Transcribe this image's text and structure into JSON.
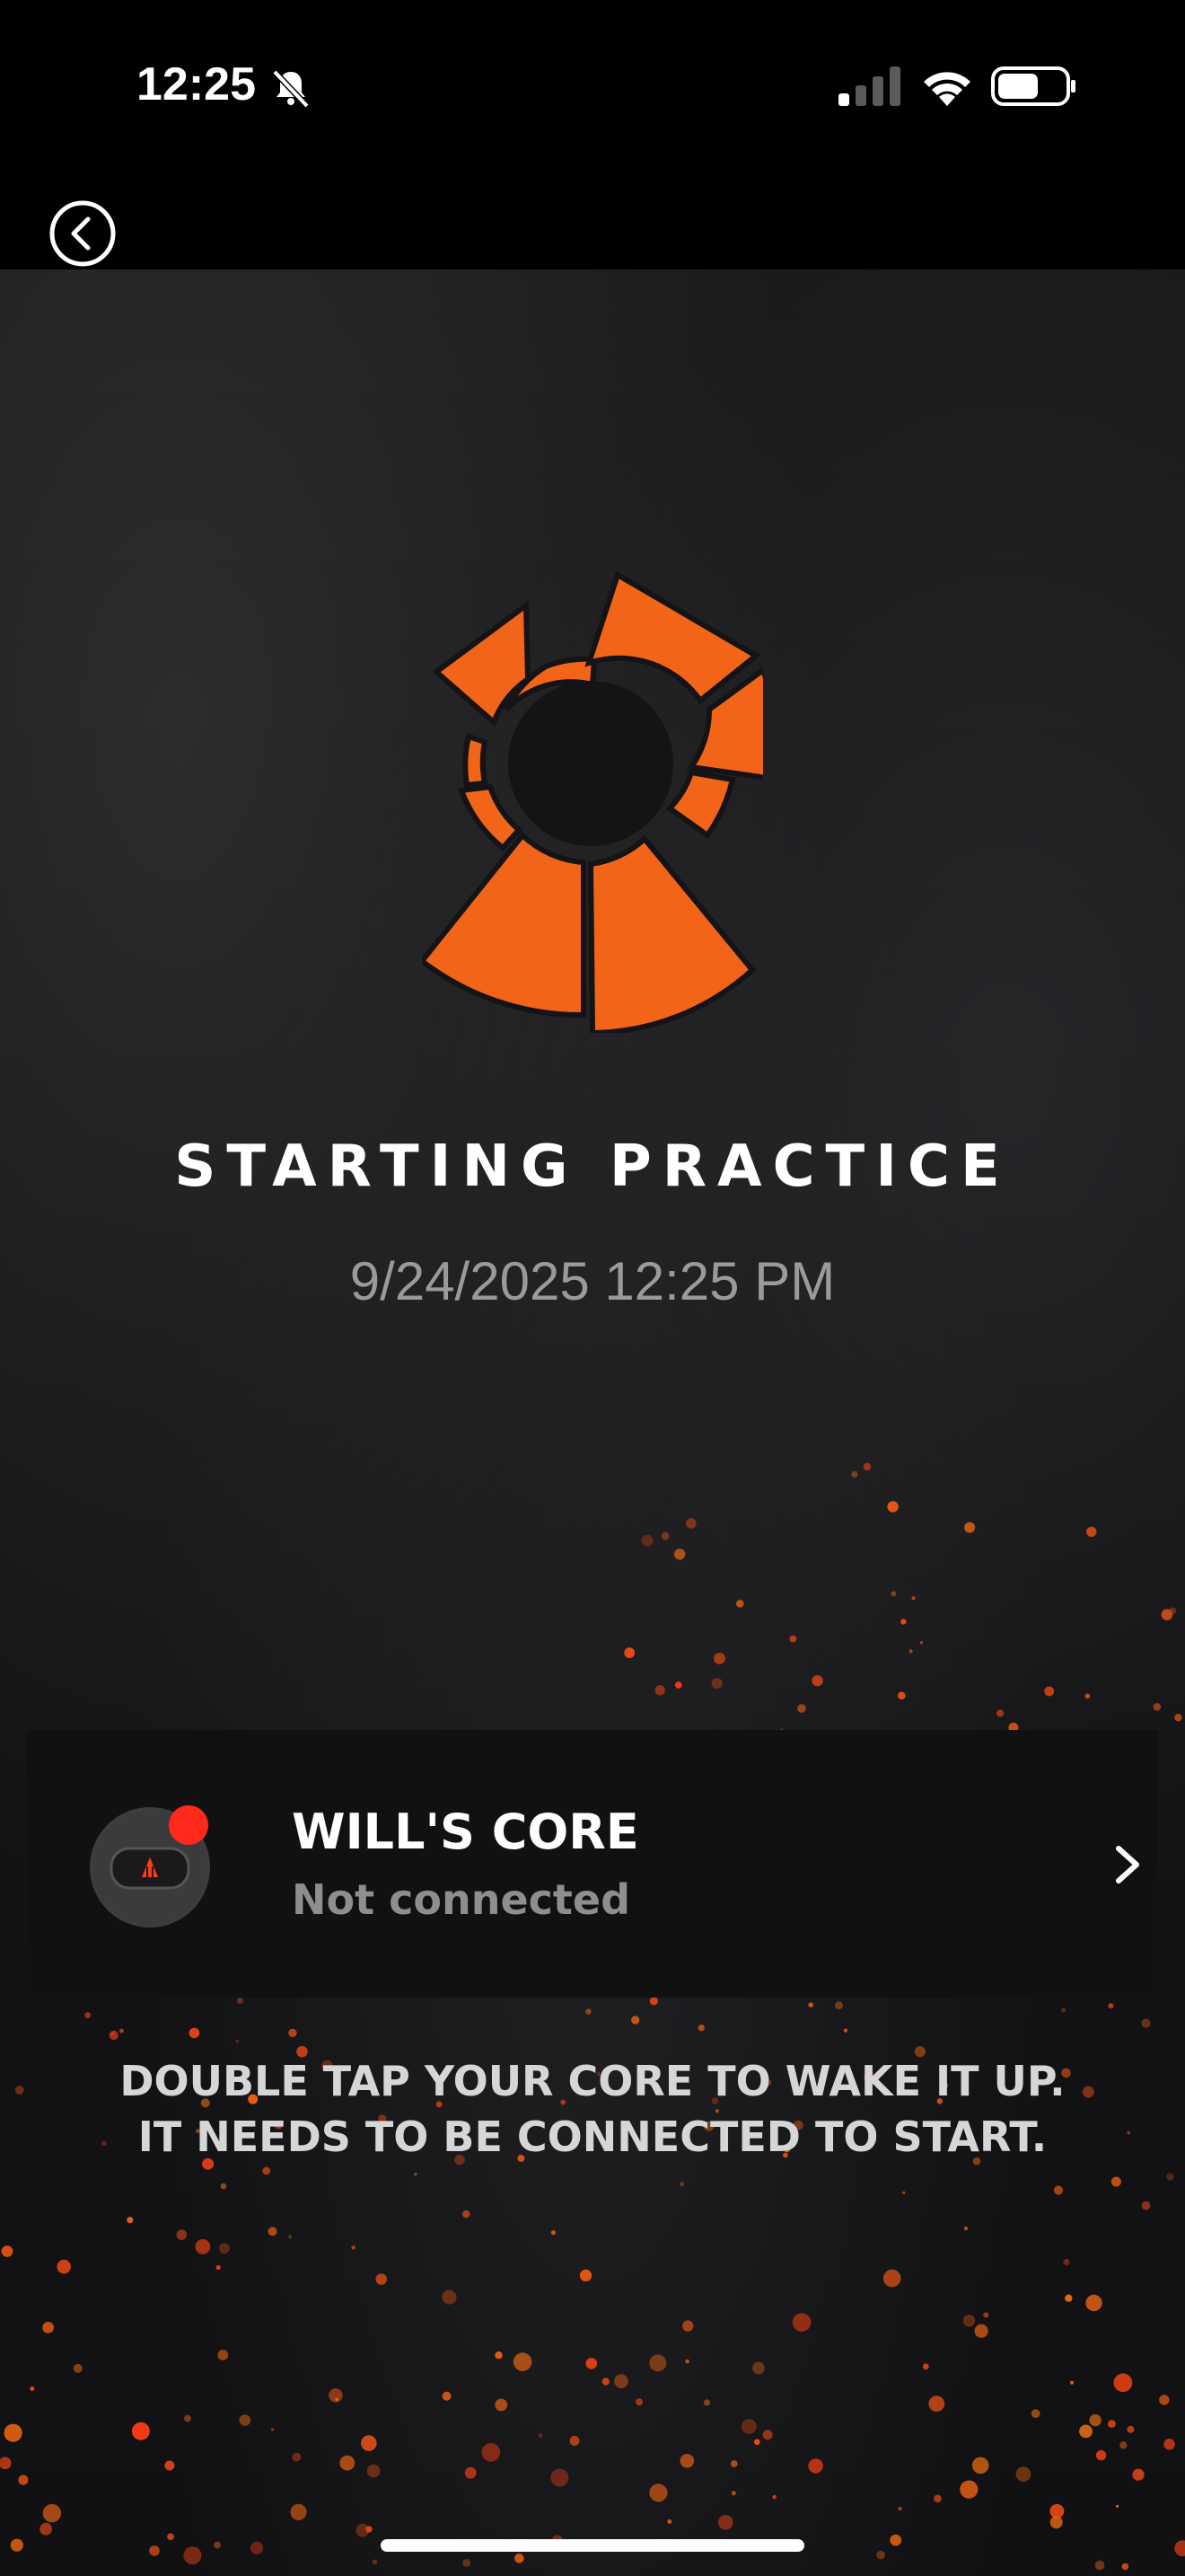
{
  "status_bar": {
    "time": "12:25",
    "bell_icon": "bell-slash-icon",
    "signal_icon": "cellular-signal-icon",
    "wifi_icon": "wifi-icon",
    "battery_icon": "battery-icon",
    "battery_level": 0.55
  },
  "header": {
    "back_icon": "chevron-left-circle-icon"
  },
  "logo": {
    "icon": "brand-logo-icon",
    "color": "#f26418"
  },
  "session": {
    "title": "STARTING PRACTICE",
    "datetime": "9/24/2025 12:25 PM"
  },
  "device": {
    "name": "WILL'S CORE",
    "status": "Not connected",
    "status_color": "#ff2a1c",
    "chevron_icon": "chevron-right-icon"
  },
  "instructions": {
    "line1": "DOUBLE TAP YOUR CORE TO WAKE IT UP.",
    "line2": "IT NEEDS TO BE CONNECTED TO START."
  }
}
